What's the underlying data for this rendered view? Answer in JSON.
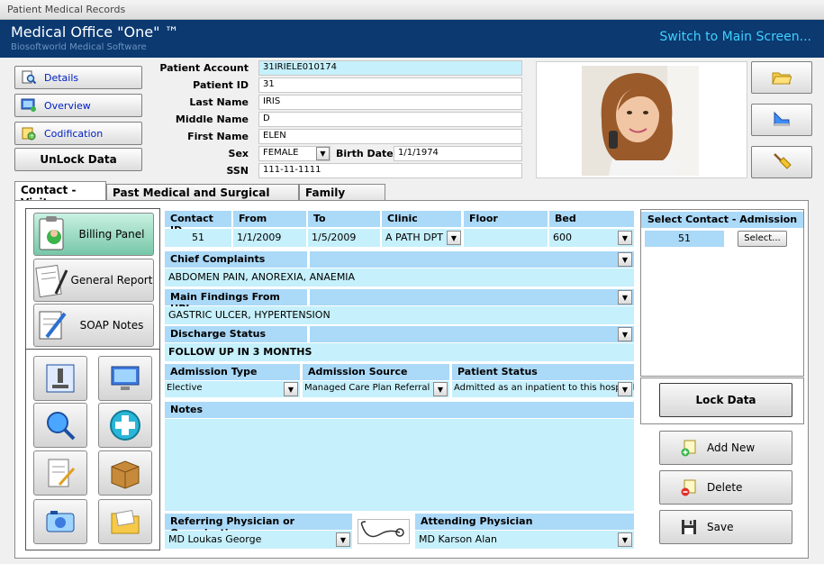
{
  "window": {
    "title": "Patient Medical Records"
  },
  "app": {
    "title": "Medical Office \"One\" ™",
    "subtitle": "Biosoftworld Medical Software",
    "switch_link": "Switch to Main Screen..."
  },
  "nav": {
    "details": "Details",
    "overview": "Overview",
    "codification": "Codification",
    "unlock": "UnLock Data"
  },
  "patient": {
    "account_label": "Patient Account",
    "account": "31IRIELE010174",
    "id_label": "Patient ID",
    "id": "31",
    "last_label": "Last Name",
    "last": "IRIS",
    "middle_label": "Middle Name",
    "middle": "D",
    "first_label": "First Name",
    "first": "ELEN",
    "sex_label": "Sex",
    "sex": "FEMALE",
    "birth_label": "Birth Date",
    "birth": "1/1/1974",
    "ssn_label": "SSN",
    "ssn": "111-11-1111"
  },
  "tabs": [
    "Contact - Visit",
    "Past Medical and Surgical History",
    "Family History"
  ],
  "left": {
    "billing": "Billing Panel",
    "general": "General Report",
    "soap": "SOAP Notes"
  },
  "contact": {
    "h_id": "Contact ID",
    "h_from": "From",
    "h_to": "To",
    "h_clinic": "Clinic",
    "h_floor": "Floor",
    "h_bed": "Bed",
    "id": "51",
    "from": "1/1/2009",
    "to": "1/5/2009",
    "clinic": "A PATH DPT",
    "floor": "",
    "bed": "600"
  },
  "chief": {
    "label": "Chief Complaints",
    "value": "ABDOMEN PAIN, ANOREXIA, ANAEMIA"
  },
  "findings": {
    "label": "Main Findings From HPI",
    "value": "GASTRIC ULCER, HYPERTENSION"
  },
  "discharge": {
    "label": "Discharge Status",
    "value": "FOLLOW UP IN 3 MONTHS"
  },
  "admission": {
    "type_label": "Admission Type",
    "type": "Elective",
    "source_label": "Admission Source",
    "source": "Managed Care Plan Referral",
    "status_label": "Patient Status",
    "status": "Admitted as an inpatient to this hospital"
  },
  "notes": {
    "label": "Notes",
    "value": ""
  },
  "referring": {
    "label": "Referring Physician or Organization",
    "value": "MD Loukas George"
  },
  "attending": {
    "label": "Attending Physician",
    "value": "MD Karson Alan"
  },
  "select_contact": {
    "title": "Select Contact - Admission",
    "id": "51",
    "button": "Select..."
  },
  "actions": {
    "lock": "Lock Data",
    "add": "Add New",
    "delete": "Delete",
    "save": "Save"
  }
}
